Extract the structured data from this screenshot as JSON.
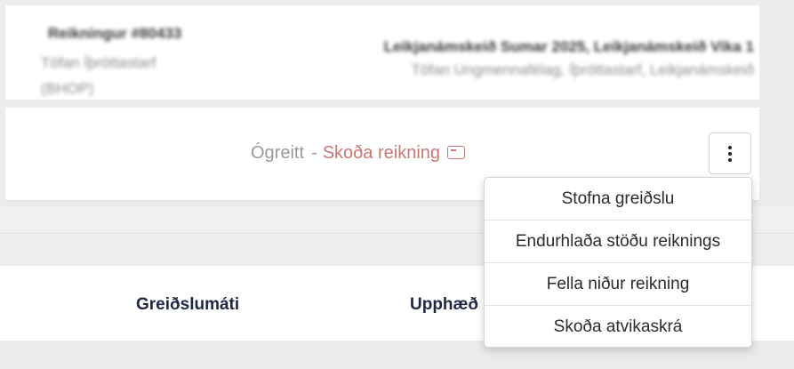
{
  "invoice": {
    "number": "Reikningur #80433",
    "issuer": "Töfan Íþróttastarf (BHOP)",
    "products": "Leikjanámskeið Sumar 2025, Leikjanámskeið Vika 1",
    "organization": "Töfan Ungmennafélag, Íþróttastarf, Leikjanámskeið"
  },
  "status": {
    "state": "Ógreitt",
    "separator": "-",
    "view_invoice_label": "Skoða reikning",
    "link_color": "#c97772"
  },
  "actions_button": {
    "icon": "kebab-vertical-icon"
  },
  "table": {
    "columns": [
      "Greiðslumáti",
      "Upphæð"
    ]
  },
  "dropdown": {
    "items": [
      "Stofna greiðslu",
      "Endurhlaða stöðu reiknings",
      "Fella niður reikning",
      "Skoða atvikaskrá"
    ]
  }
}
